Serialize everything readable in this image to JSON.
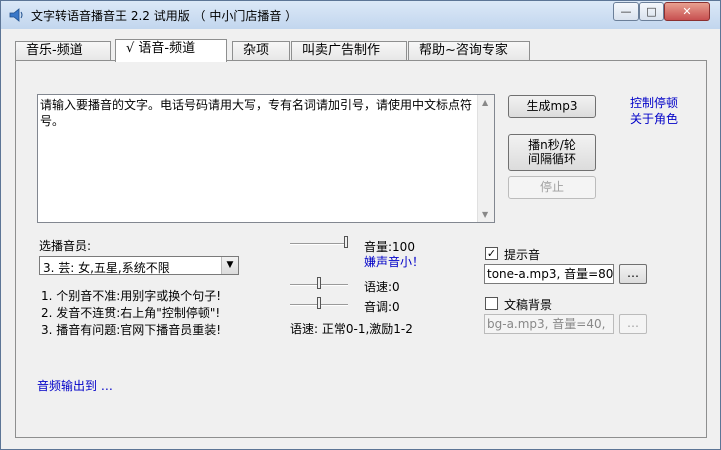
{
  "window": {
    "title": "文字转语音播音王 2.2 试用版 （ 中小门店播音 ）",
    "icon": "speaker-icon",
    "min_label": "—",
    "max_label": "□",
    "close_label": "✕"
  },
  "tabs": [
    {
      "label": "音乐-频道"
    },
    {
      "label": "√ 语音-频道",
      "active": true
    },
    {
      "label": "杂项"
    },
    {
      "label": "叫卖广告制作"
    },
    {
      "label": "帮助~咨询专家"
    }
  ],
  "editor": {
    "text": "请输入要播音的文字。电话号码请用大写，专有名词请加引号，请使用中文标点符号。",
    "scroll_up": "▲",
    "scroll_down": "▼"
  },
  "buttons": {
    "generate": "生成mp3",
    "play_loop_line1": "播n秒/轮",
    "play_loop_line2": "间隔循环",
    "stop": "停止"
  },
  "links": {
    "control_pause": "控制停顿",
    "about_role": "关于角色",
    "audio_output": "音频输出到 …",
    "volume_small": "嫌声音小！"
  },
  "voice": {
    "label": "选播音员:",
    "selected": "3. 芸: 女,五星,系统不限",
    "arrow": "▼"
  },
  "tips": [
    "1.  个别音不准:用别字或换个句子!",
    "2.  发音不连贯:右上角\"控制停顿\"!",
    "3.  播音有问题:官网下播音员重装!"
  ],
  "sliders": {
    "volume": {
      "label": "音量:100",
      "value": 100
    },
    "speed": {
      "label": "语速:0",
      "value": 0
    },
    "pitch": {
      "label": "音调:0",
      "value": 0
    },
    "speed_hint": "语速:  正常0-1,激励1-2"
  },
  "prompt_sound": {
    "label": "提示音",
    "checked": true,
    "value": "tone-a.mp3, 音量=80",
    "browse": "…"
  },
  "background": {
    "label": "文稿背景",
    "checked": false,
    "value": "bg-a.mp3, 音量=40,",
    "browse": "…"
  }
}
